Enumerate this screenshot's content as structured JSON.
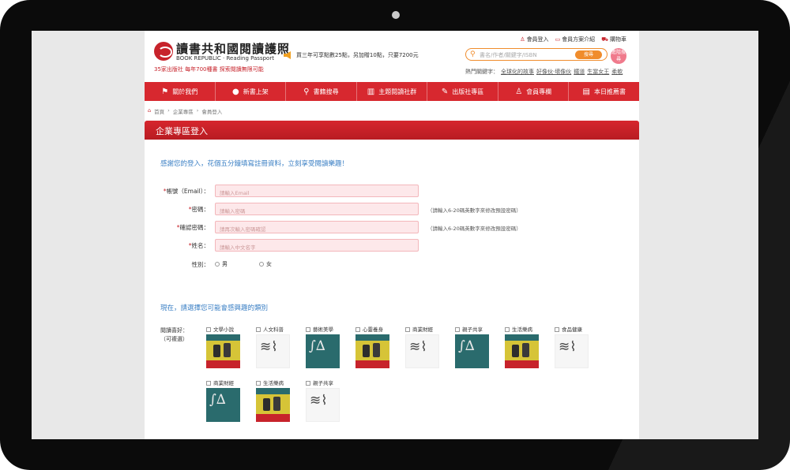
{
  "header": {
    "logo_title": "讀書共和國閱讀護照",
    "logo_subtitle": "BOOK REPUBLIC · Reading Passport",
    "tagline": "35家出版社  每年700種書  探索閱讀無限可能",
    "promo": "買三年可享點數25點，另加贈10點，只要7200元",
    "top_links": [
      "會員登入",
      "會員方案介紹",
      "購物車"
    ],
    "search_placeholder": "書名/作者/關鍵字/ISBN",
    "search_button": "搜尋",
    "advanced_search": "進階搜尋",
    "hot_label": "熱門關鍵字：",
    "hot_keywords": [
      "全球化的故事",
      "好像伙·壞像伙",
      "鐵道",
      "生當女王",
      "柔軟"
    ]
  },
  "nav": [
    "關於我們",
    "新書上架",
    "書籍搜尋",
    "主題閱讀社群",
    "出版社專區",
    "會員專欄",
    "本日推薦書"
  ],
  "breadcrumb": [
    "首頁",
    "企業專區",
    "會員登入"
  ],
  "panel_title": "企業專區登入",
  "intro": "感謝您的登入，花個五分鐘填寫註冊資料，立刻享受閱讀樂趣！",
  "form": {
    "account": {
      "label": "帳號（Email）：",
      "placeholder": "請輸入Email"
    },
    "password": {
      "label": "密碼：",
      "placeholder": "請輸入密碼",
      "hint": "（請輸入6-20碼英數字來修改預設密碼）"
    },
    "confirm": {
      "label": "確認密碼：",
      "placeholder": "請再次輸入密碼確認",
      "hint": "（請輸入6-20碼英數字來修改預設密碼）"
    },
    "name": {
      "label": "姓名：",
      "placeholder": "請輸入中文名字"
    },
    "gender": {
      "label": "性別：",
      "options": [
        "男",
        "女"
      ]
    }
  },
  "categories_title": "現在，請選擇您可能會感興趣的類別",
  "categories_label_line1": "閱讀喜好：",
  "categories_label_line2": "（可複選）",
  "categories": [
    {
      "name": "文學小說",
      "style": "yellow"
    },
    {
      "name": "人文科普",
      "style": "white"
    },
    {
      "name": "藝術美學",
      "style": "teal"
    },
    {
      "name": "心靈養身",
      "style": "yellow"
    },
    {
      "name": "商業財經",
      "style": "white"
    },
    {
      "name": "親子共享",
      "style": "teal"
    },
    {
      "name": "生活樂病",
      "style": "yellow"
    },
    {
      "name": "食品健康",
      "style": "white"
    },
    {
      "name": "商業財經",
      "style": "teal"
    },
    {
      "name": "生活樂病",
      "style": "yellow"
    },
    {
      "name": "親子共享",
      "style": "white"
    }
  ]
}
